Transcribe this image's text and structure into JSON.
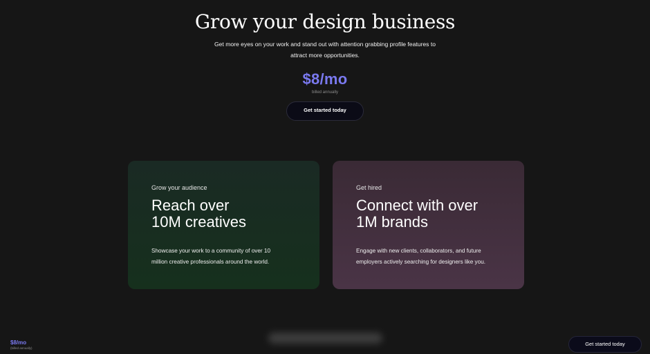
{
  "hero": {
    "title": "Grow your design business",
    "subtitle": "Get more eyes on your work and stand out with attention grabbing profile features to attract more opportunities.",
    "price": "$8/mo",
    "billed": "billed annually",
    "cta_label": "Get started today"
  },
  "cards": [
    {
      "eyebrow": "Grow your audience",
      "headline": "Reach over\n10M creatives",
      "body": "Showcase your work to a community of over 10\nmillion creative professionals around the world."
    },
    {
      "eyebrow": "Get hired",
      "headline": "Connect with over\n1M brands",
      "body": "Engage with new clients, collaborators, and future\nemployers actively searching for designers like you."
    }
  ],
  "footer": {
    "price": "$8/mo",
    "billed": "(billed annually)",
    "cta_label": "Get started today"
  },
  "colors": {
    "accent": "#7a79ef",
    "background": "#161616"
  }
}
